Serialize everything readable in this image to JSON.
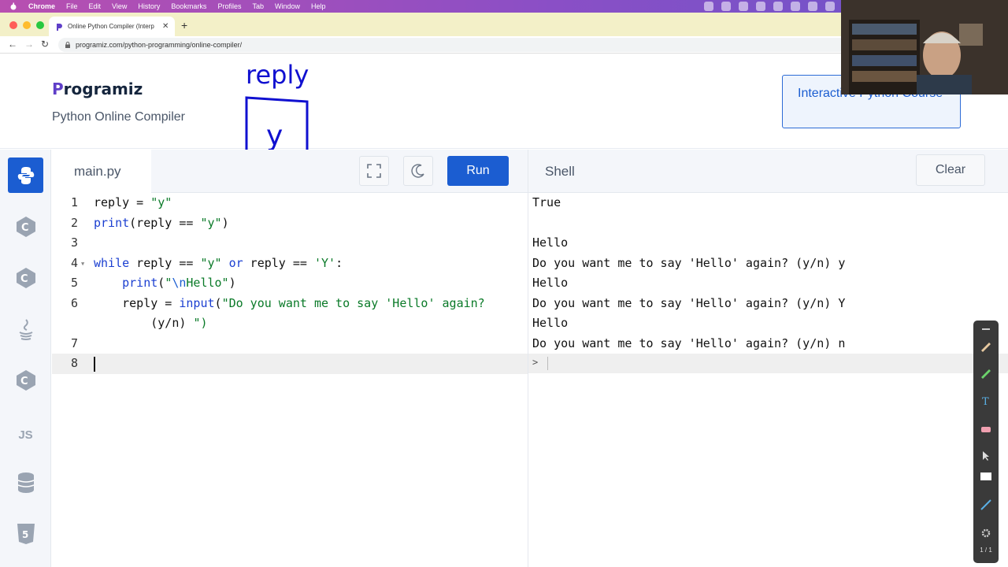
{
  "menubar": {
    "items": [
      "Chrome",
      "File",
      "Edit",
      "View",
      "History",
      "Bookmarks",
      "Profiles",
      "Tab",
      "Window",
      "Help"
    ]
  },
  "browser": {
    "tab_title": "Online Python Compiler (Interp",
    "url": "programiz.com/python-programming/online-compiler/"
  },
  "header": {
    "logo_rest": "rogramiz",
    "subtitle": "Python Online Compiler",
    "course_button": "Interactive Python Course"
  },
  "annotation": {
    "word": "reply",
    "box_value": "y"
  },
  "editor": {
    "file_name": "main.py",
    "run_label": "Run",
    "line_numbers": [
      "1",
      "2",
      "3",
      "4",
      "5",
      "6",
      "",
      "7",
      "8"
    ],
    "lines": [
      "reply = \"y\"",
      "print(reply == \"y\")",
      "",
      "while reply == \"y\" or reply == 'Y':",
      "    print(\"\\nHello\")",
      "    reply = input(\"Do you want me to say 'Hello' again?",
      "        (y/n) \")",
      "",
      ""
    ]
  },
  "sidebar": {
    "items": [
      "python",
      "c",
      "cpp",
      "java",
      "csharp",
      "JS",
      "sql",
      "html5"
    ]
  },
  "shell": {
    "title": "Shell",
    "clear_label": "Clear",
    "output": [
      "True",
      "",
      "Hello",
      "Do you want me to say 'Hello' again? (y/n) y",
      "Hello",
      "Do you want me to say 'Hello' again? (y/n) Y",
      "Hello",
      "Do you want me to say 'Hello' again? (y/n) n"
    ],
    "prompt": ">"
  },
  "palette": {
    "page_count": "1 / 1"
  },
  "colors": {
    "accent": "#1b5dd1",
    "string": "#0a7a28",
    "keyword": "#1b3fd1"
  }
}
